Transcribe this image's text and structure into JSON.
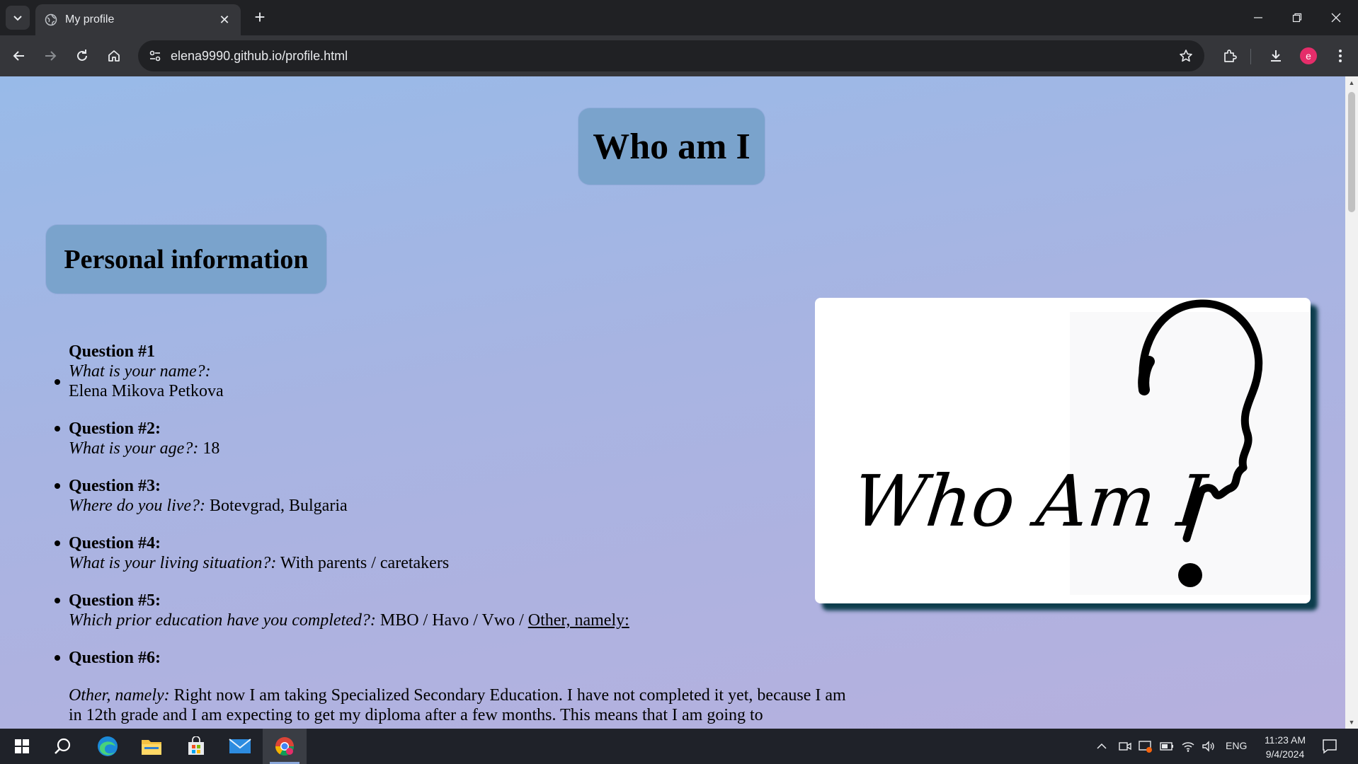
{
  "browser": {
    "tab_title": "My profile",
    "url": "elena9990.github.io/profile.html",
    "avatar_letter": "e"
  },
  "page": {
    "title": "Who am I",
    "section_title": "Personal information",
    "image_text": "Who Am I",
    "questions": [
      {
        "label": "Question #1",
        "prompt": "What is your name?:",
        "answer": "Elena Mikova Petkova"
      },
      {
        "label": "Question #2:",
        "prompt": "What is your age?:",
        "answer": "18"
      },
      {
        "label": "Question #3:",
        "prompt": "Where do you live?:",
        "answer": "Botevgrad, Bulgaria"
      },
      {
        "label": "Question #4:",
        "prompt": "What is your living situation?:",
        "answer": "With parents / caretakers"
      },
      {
        "label": "Question #5:",
        "prompt": "Which prior education have you completed?:",
        "answer": "MBO / Havo / Vwo /",
        "link": "Other, namely:"
      },
      {
        "label": "Question #6:",
        "prompt": "Other, namely:",
        "answer": "Right now I am taking Specialized Secondary Education. I have not completed it yet, because I am in 12th grade and I am expecting to get my diploma after a few months. This means that I am going to"
      }
    ]
  },
  "taskbar": {
    "language": "ENG",
    "time": "11:23 AM",
    "date": "9/4/2024"
  }
}
